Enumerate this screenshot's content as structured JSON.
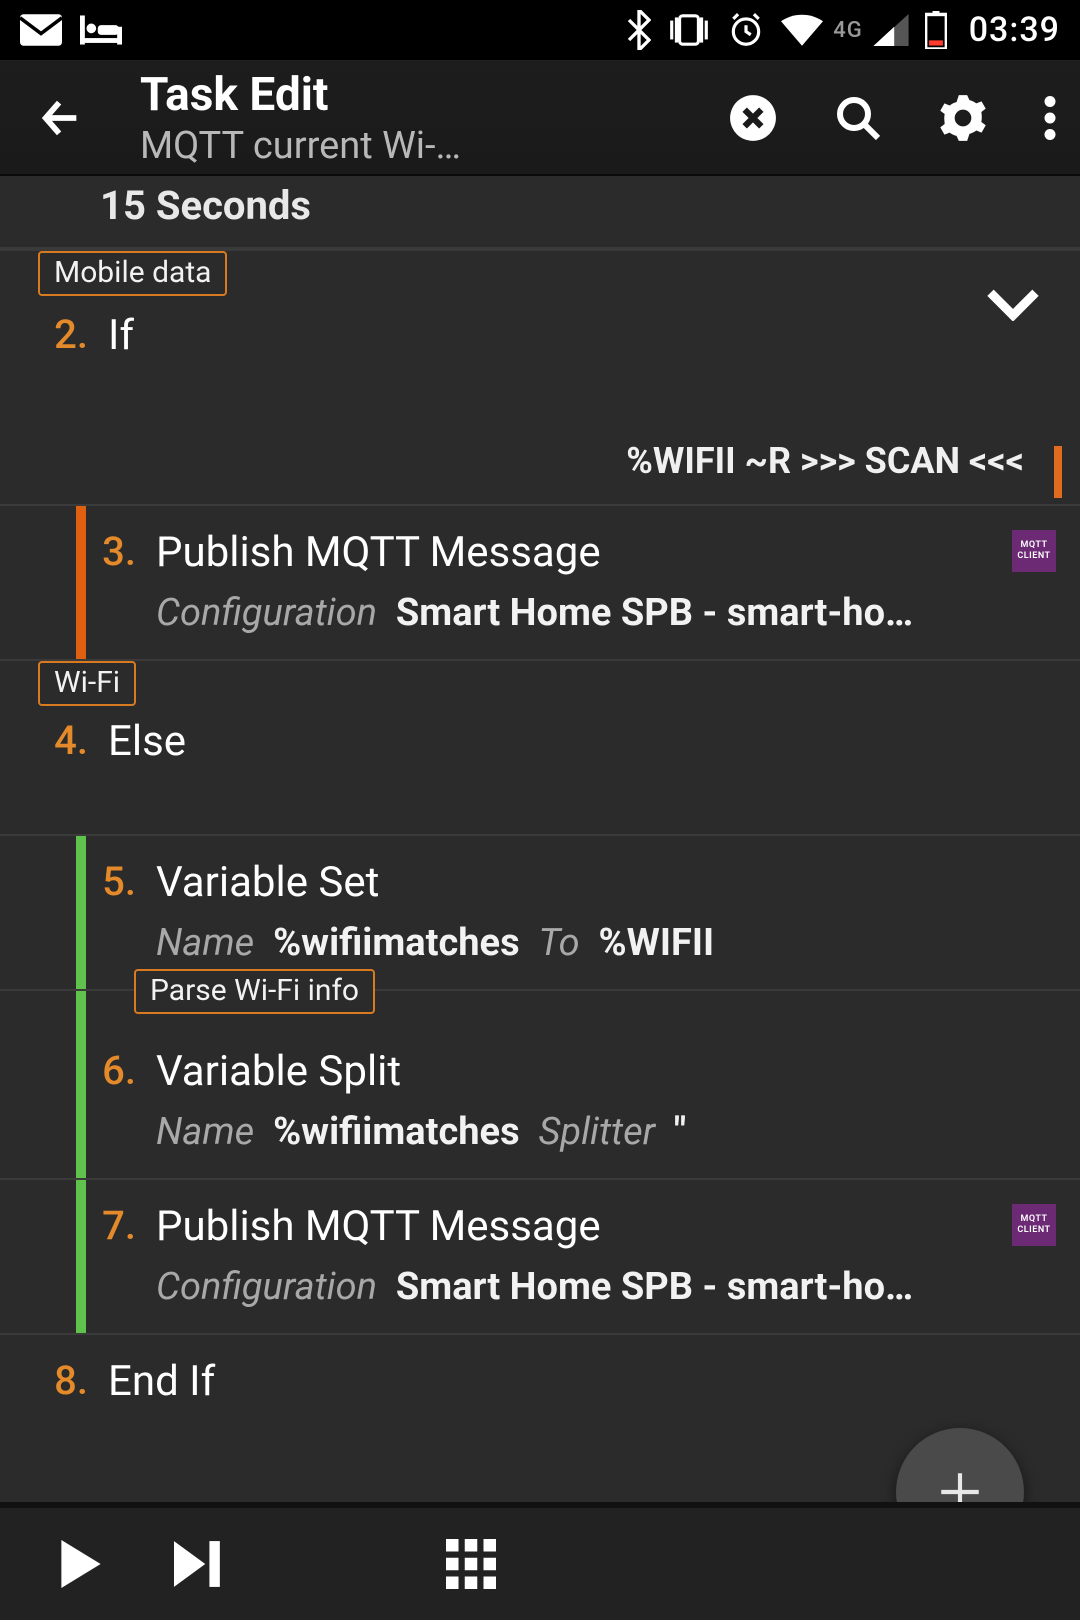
{
  "status": {
    "network_label": "4G",
    "clock": "03:39"
  },
  "appbar": {
    "title": "Task Edit",
    "subtitle": "MQTT current Wi-Fi…"
  },
  "truncated_top": "15 Seconds",
  "chips": {
    "mobile": "Mobile data",
    "wifi": "Wi-Fi",
    "parse": "Parse Wi-Fi info"
  },
  "steps": {
    "s2": {
      "num": "2.",
      "title": "If",
      "cond": "%WIFII ~R >>> SCAN <<<"
    },
    "s3": {
      "num": "3.",
      "title": "Publish MQTT Message",
      "label": "Configuration",
      "value": "Smart Home SPB - smart-ho…"
    },
    "s4": {
      "num": "4.",
      "title": "Else"
    },
    "s5": {
      "num": "5.",
      "title": "Variable Set",
      "k1": "Name",
      "v1": "%wifiimatches",
      "k2": "To",
      "v2": "%WIFII"
    },
    "s6": {
      "num": "6.",
      "title": "Variable Split",
      "k1": "Name",
      "v1": "%wifiimatches",
      "k2": "Splitter",
      "v2": "\""
    },
    "s7": {
      "num": "7.",
      "title": "Publish MQTT Message",
      "label": "Configuration",
      "value": "Smart Home SPB - smart-ho…"
    },
    "s8": {
      "num": "8.",
      "title": "End If"
    }
  },
  "plugin_badge": {
    "l1": "MQTT",
    "l2": "CLIENT"
  }
}
